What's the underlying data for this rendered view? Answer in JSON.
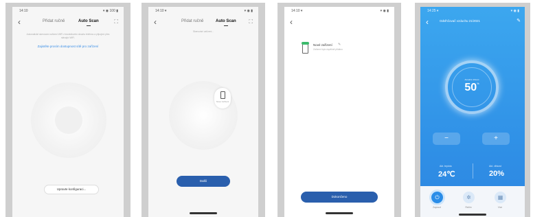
{
  "panel1": {
    "status_time": "14:10",
    "status_icons": "▾ ◉ 100 ▮",
    "nav": {
      "back": "‹",
      "tab_manual": "Přidat ručně",
      "tab_auto": "Auto Scan",
      "scan": "⛶"
    },
    "hint": "Automatické skenování zařízení WiFi v bezdrátovém dosahu telefonu a připojení přes stávající WiFi.",
    "link": "Zajistěte prosím dostupnost sítě pro zařízení",
    "button": "Upravte konfiguraci..."
  },
  "panel2": {
    "status_time": "14:10 ▾",
    "status_icons": "▾ ◉ ▮",
    "nav": {
      "back": "‹",
      "tab_manual": "Přidat ručně",
      "tab_auto": "Auto Scan",
      "scan": "⛶"
    },
    "subtitle": "Skenování zařízení...",
    "device_label": "Nové zařízení",
    "button": "Další"
  },
  "panel3": {
    "status_time": "14:10 ▾",
    "status_icons": "▾ ◉ ▮",
    "back": "‹",
    "device_name": "Nové zařízení",
    "device_sub": "Zařízení bylo úspěšně přidáno",
    "button": "Dokončeno"
  },
  "panel4": {
    "status_time": "14:25 ▾",
    "status_icons": "▾ ◉ ▮",
    "back": "‹",
    "title": "Odvlhčovač vzduchu 21/2021",
    "edit": "✎",
    "gauge_label": "Aktuální vlhkost",
    "gauge_value": "50",
    "gauge_unit": "%",
    "minus": "−",
    "plus": "+",
    "stat1_label": "Akt. teplota",
    "stat1_value": "24℃",
    "stat2_label": "Akt. vlhkost",
    "stat2_value": "20%",
    "btn_power": "Zapnout",
    "btn_mode": "Režim",
    "btn_more": "Více",
    "colors": {
      "accent": "#2f8fe6",
      "power": "#2a8de8"
    }
  }
}
